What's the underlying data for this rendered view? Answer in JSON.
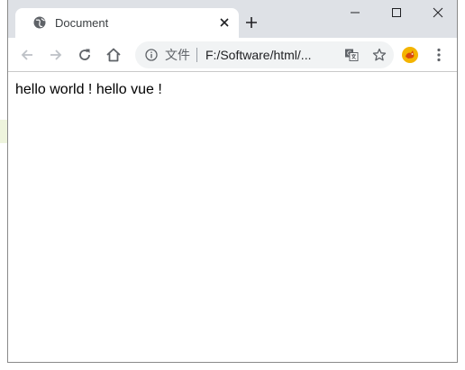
{
  "tab": {
    "title": "Document"
  },
  "address_bar": {
    "security_label": "文件",
    "url": "F:/Software/html/..."
  },
  "page": {
    "text": "hello world ! hello vue !"
  },
  "icons": {
    "favicon": "globe-icon",
    "tab_close": "close-icon",
    "new_tab": "plus-icon",
    "back": "arrow-left-icon",
    "forward": "arrow-right-icon",
    "reload": "reload-icon",
    "home": "home-icon",
    "info": "info-icon",
    "translate": "translate-icon",
    "bookmark": "star-icon",
    "extension": "extension-icon",
    "menu": "kebab-menu-icon",
    "minimize": "minimize-icon",
    "maximize": "maximize-icon",
    "close_window": "close-icon"
  },
  "colors": {
    "tabstrip_bg": "#dee1e6",
    "omnibox_bg": "#f1f3f4",
    "text_primary": "#202124",
    "icon_gray": "#5f6368",
    "extension_accent": "#f4b400"
  }
}
